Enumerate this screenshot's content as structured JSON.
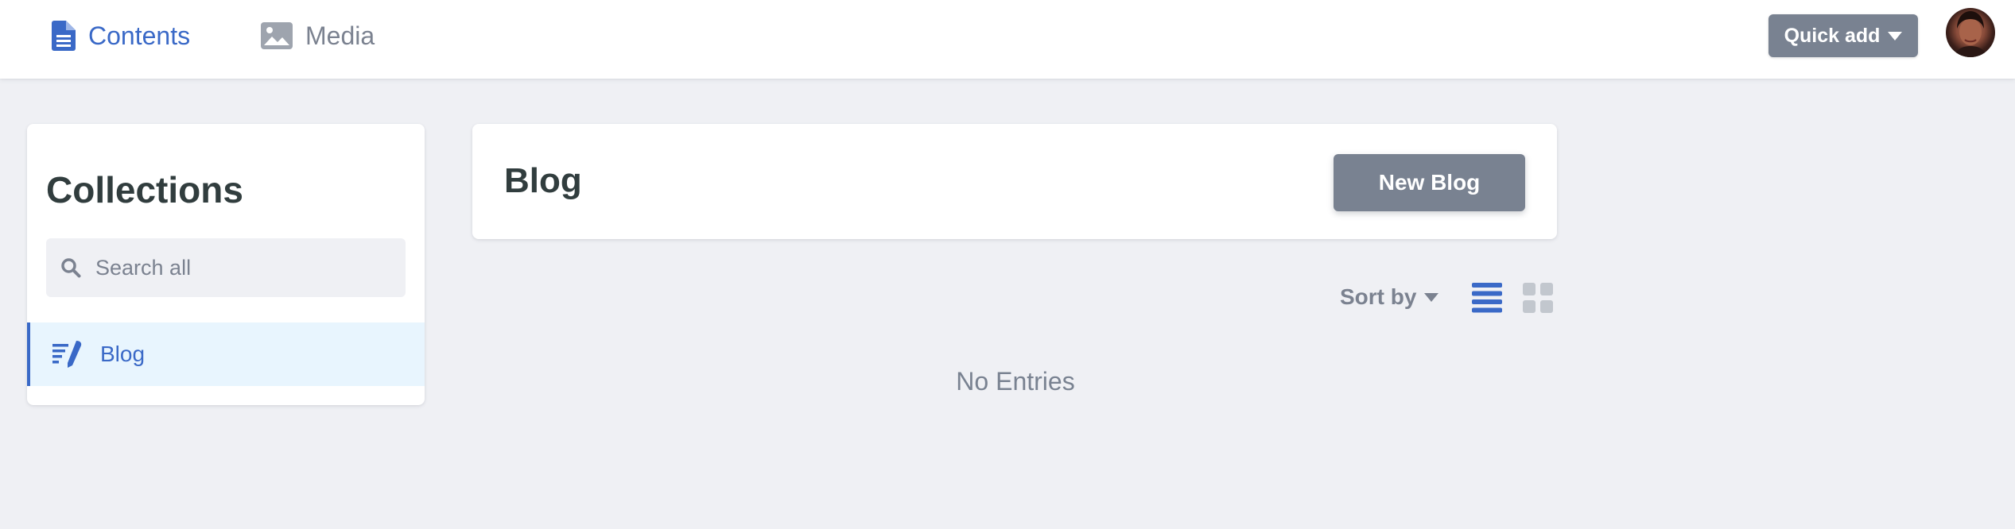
{
  "nav": {
    "contents_label": "Contents",
    "media_label": "Media",
    "quick_add_label": "Quick add"
  },
  "sidebar": {
    "title": "Collections",
    "search_placeholder": "Search all",
    "items": [
      {
        "label": "Blog",
        "icon": "write-icon",
        "active": true
      }
    ]
  },
  "main": {
    "title": "Blog",
    "new_button_label": "New Blog",
    "sort_label": "Sort by",
    "view_mode": "list",
    "empty_text": "No Entries"
  },
  "colors": {
    "accent": "#3a69c7",
    "button_bg": "#798291",
    "text_dark": "#313d3e",
    "text_muted": "#7b8290",
    "page_bg": "#eff0f4",
    "active_item_bg": "#e8f5fe"
  }
}
